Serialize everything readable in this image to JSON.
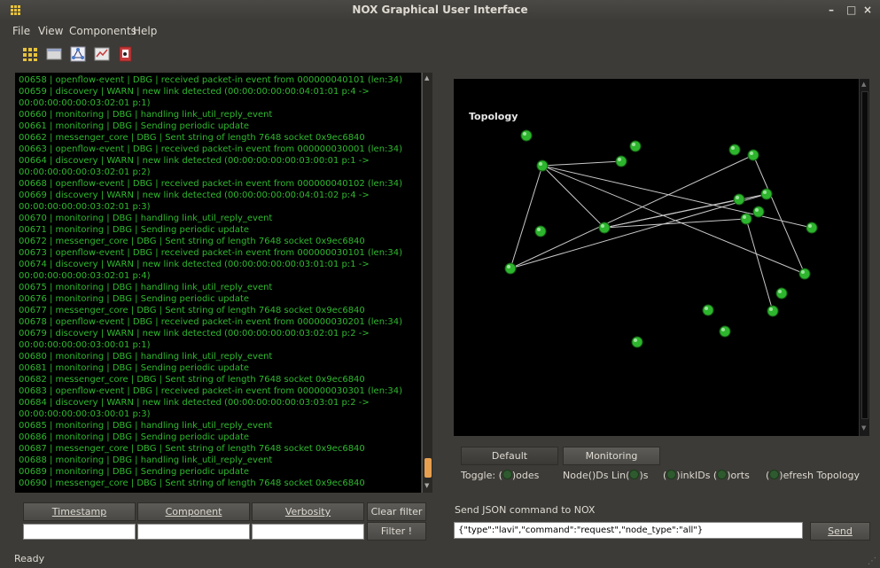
{
  "window": {
    "title": "NOX Graphical User Interface",
    "minimize": "–",
    "maximize": "□",
    "close": "×"
  },
  "menu": [
    {
      "label": "File"
    },
    {
      "label": "View"
    },
    {
      "label": "Components"
    },
    {
      "label": "Help"
    }
  ],
  "toolbar": [
    "components-icon",
    "console-icon",
    "topology-icon",
    "monitor-icon",
    "exit-icon"
  ],
  "log": [
    "00658 | openflow-event | DBG | received packet-in event from 000000040101 (len:34)",
    "00659 | discovery | WARN | new link detected (00:00:00:00:00:04:01:01 p:4 ->",
    "00:00:00:00:00:03:02:01 p:1)",
    "00660 | monitoring | DBG | handling link_util_reply_event",
    "00661 | monitoring | DBG | Sending periodic update",
    "00662 | messenger_core | DBG | Sent string of length 7648 socket 0x9ec6840",
    "00663 | openflow-event | DBG | received packet-in event from 000000030001 (len:34)",
    "00664 | discovery | WARN | new link detected (00:00:00:00:00:03:00:01 p:1 ->",
    "00:00:00:00:00:03:02:01 p:2)",
    "00668 | openflow-event | DBG | received packet-in event from 000000040102 (len:34)",
    "00669 | discovery | WARN | new link detected (00:00:00:00:00:04:01:02 p:4 ->",
    "00:00:00:00:00:03:02:01 p:3)",
    "00670 | monitoring | DBG | handling link_util_reply_event",
    "00671 | monitoring | DBG | Sending periodic update",
    "00672 | messenger_core | DBG | Sent string of length 7648 socket 0x9ec6840",
    "00673 | openflow-event | DBG | received packet-in event from 000000030101 (len:34)",
    "00674 | discovery | WARN | new link detected (00:00:00:00:00:03:01:01 p:1 ->",
    "00:00:00:00:00:03:02:01 p:4)",
    "00675 | monitoring | DBG | handling link_util_reply_event",
    "00676 | monitoring | DBG | Sending periodic update",
    "00677 | messenger_core | DBG | Sent string of length 7648 socket 0x9ec6840",
    "00678 | openflow-event | DBG | received packet-in event from 000000030201 (len:34)",
    "00679 | discovery | WARN | new link detected (00:00:00:00:00:03:02:01 p:2 ->",
    "00:00:00:00:00:03:00:01 p:1)",
    "00680 | monitoring | DBG | handling link_util_reply_event",
    "00681 | monitoring | DBG | Sending periodic update",
    "00682 | messenger_core | DBG | Sent string of length 7648 socket 0x9ec6840",
    "00683 | openflow-event | DBG | received packet-in event from 000000030301 (len:34)",
    "00684 | discovery | WARN | new link detected (00:00:00:00:00:03:03:01 p:2 ->",
    "00:00:00:00:00:03:00:01 p:3)",
    "00685 | monitoring | DBG | handling link_util_reply_event",
    "00686 | monitoring | DBG | Sending periodic update",
    "00687 | messenger_core | DBG | Sent string of length 7648 socket 0x9ec6840",
    "00688 | monitoring | DBG | handling link_util_reply_event",
    "00689 | monitoring | DBG | Sending periodic update",
    "00690 | messenger_core | DBG | Sent string of length 7648 socket 0x9ec6840"
  ],
  "filters": {
    "timestamp": "Timestamp",
    "component": "Component",
    "verbosity": "Verbosity",
    "clear": "Clear filter",
    "filter": "Filter !",
    "timestamp_value": "",
    "component_value": "",
    "verbosity_value": ""
  },
  "topology": {
    "label": "Topology",
    "node_color": "#2db52d",
    "link_color": "#c8c8c8"
  },
  "views": {
    "default": "Default",
    "monitoring": "Monitoring"
  },
  "toggles": {
    "prefix": "Toggle:",
    "nodes": "odes",
    "node_ids_a": "Node(",
    "node_ids_b": ")Ds Lin(",
    "node_ids_c": ")s",
    "link_ids": "inkIDs (",
    "ports": ")orts",
    "refresh": "efresh Topology"
  },
  "command": {
    "label": "Send JSON command to NOX",
    "value": "{\"type\":\"lavi\",\"command\":\"request\",\"node_type\":\"all\"}",
    "send": "Send"
  },
  "status": "Ready"
}
